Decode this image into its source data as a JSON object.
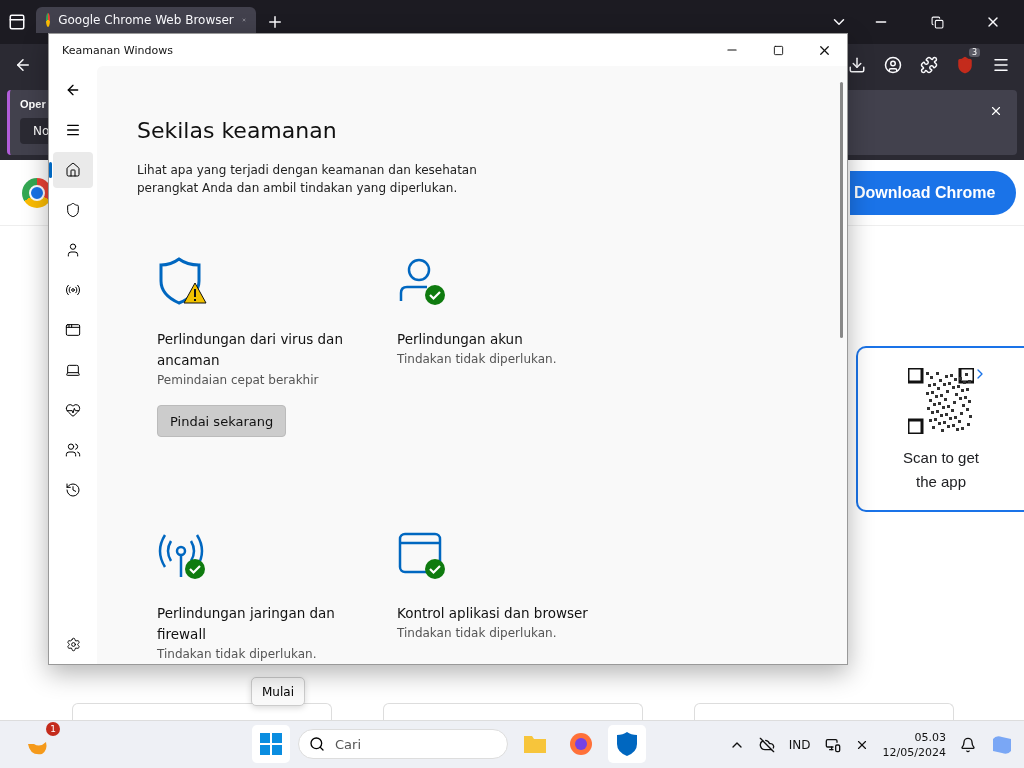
{
  "browser": {
    "tab": {
      "title": "Google Chrome Web Browser",
      "selected": true
    },
    "extension_badge": "3",
    "notice": {
      "title": "Oper",
      "button": "No"
    },
    "page": {
      "download_button": "Download Chrome",
      "qr_card": {
        "text": "Scan to get the app"
      }
    }
  },
  "window": {
    "title": "Keamanan Windows",
    "nav": [
      {
        "kind": "home",
        "selected": true
      },
      {
        "kind": "shield",
        "selected": false
      },
      {
        "kind": "account",
        "selected": false
      },
      {
        "kind": "network",
        "selected": false
      },
      {
        "kind": "app",
        "selected": false
      },
      {
        "kind": "device",
        "selected": false
      },
      {
        "kind": "health",
        "selected": false
      },
      {
        "kind": "family",
        "selected": false
      },
      {
        "kind": "history",
        "selected": false
      }
    ],
    "heading": "Sekilas keamanan",
    "description": "Lihat apa yang terjadi dengan keamanan dan kesehatan perangkat Anda dan ambil tindakan yang diperlukan.",
    "cards": [
      {
        "kind": "virus",
        "warning": true,
        "title": "Perlindungan dari virus dan ancaman",
        "detail": "Pemindaian cepat berakhir",
        "button": "Pindai sekarang"
      },
      {
        "kind": "account",
        "warning": false,
        "title": "Perlindungan akun",
        "detail": "Tindakan tidak diperlukan."
      },
      {
        "kind": "network",
        "warning": false,
        "title": "Perlindungan jaringan dan firewall",
        "detail": "Tindakan tidak diperlukan."
      },
      {
        "kind": "app",
        "warning": false,
        "title": "Kontrol aplikasi dan browser",
        "detail": "Tindakan tidak diperlukan."
      }
    ]
  },
  "tooltip": "Mulai",
  "taskbar": {
    "app_badge": "1",
    "search_placeholder": "Cari",
    "language": "IND",
    "time": "05.03",
    "date": "12/05/2024"
  }
}
